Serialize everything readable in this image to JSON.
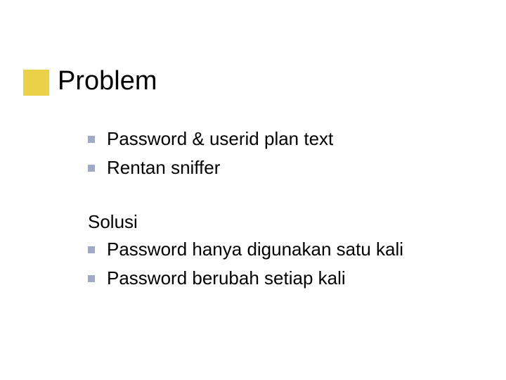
{
  "title": "Problem",
  "bullets1": [
    "Password & userid plan text",
    "Rentan sniffer"
  ],
  "sectionLabel": "Solusi",
  "bullets2": [
    "Password hanya digunakan satu kali",
    "Password berubah setiap kali"
  ]
}
